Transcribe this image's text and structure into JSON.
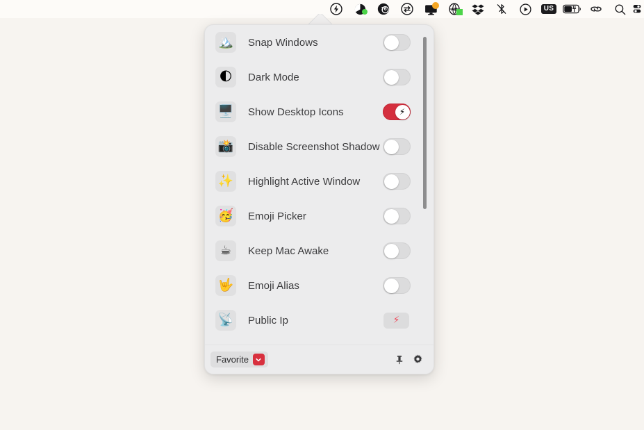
{
  "menubar": {
    "background": "#fdfbf8",
    "items": [
      {
        "name": "one-switch-icon",
        "icon": "bolt-circle",
        "badge": "none"
      },
      {
        "name": "battery-health-icon",
        "icon": "pie-circle",
        "badge": "green-dot"
      },
      {
        "name": "disk-space-icon",
        "icon": "circle-76",
        "label": "76",
        "badge": "none"
      },
      {
        "name": "transfer-icon",
        "icon": "arrows-circle",
        "badge": "none"
      },
      {
        "name": "display-icon",
        "icon": "monitor",
        "badge": "orange-dot"
      },
      {
        "name": "ad-blocker-icon",
        "icon": "ad-shield",
        "badge": "green-square"
      },
      {
        "name": "dropbox-icon",
        "icon": "dropbox",
        "badge": "none"
      },
      {
        "name": "bluetooth-off-icon",
        "icon": "bluetooth-slash",
        "badge": "none"
      },
      {
        "name": "now-playing-icon",
        "icon": "play-circle",
        "badge": "none"
      },
      {
        "name": "input-source-icon",
        "icon": "us-badge",
        "label": "US",
        "badge": "none"
      },
      {
        "name": "battery-icon",
        "icon": "battery-charging",
        "badge": "none"
      },
      {
        "name": "link-icon",
        "icon": "link-chain",
        "badge": "none"
      },
      {
        "name": "spotlight-search-icon",
        "icon": "magnifier",
        "badge": "none"
      },
      {
        "name": "control-center-icon",
        "icon": "control-center",
        "badge": "none"
      }
    ]
  },
  "panel": {
    "background": "#ececed",
    "accent_on": "#d42f3e",
    "accent_bolt": "#ef4a5c",
    "rows": [
      {
        "icon": "🏔️",
        "icon_name": "snow-mountain-emoji",
        "label": "Snap Windows",
        "control": "toggle",
        "state": "off"
      },
      {
        "icon": "🌓",
        "icon_name": "first-quarter-moon-emoji",
        "label": "Dark Mode",
        "control": "toggle",
        "state": "off"
      },
      {
        "icon": "🖥️",
        "icon_name": "desktop-computer-emoji",
        "label": "Show Desktop Icons",
        "control": "toggle",
        "state": "on",
        "knob_glyph": "⚡"
      },
      {
        "icon": "📸",
        "icon_name": "camera-flash-emoji",
        "label": "Disable Screenshot Shadow",
        "control": "toggle",
        "state": "off"
      },
      {
        "icon": "✨",
        "icon_name": "sparkles-emoji",
        "label": "Highlight Active Window",
        "control": "toggle",
        "state": "off"
      },
      {
        "icon": "🥳",
        "icon_name": "partying-face-emoji",
        "label": "Emoji Picker",
        "control": "toggle",
        "state": "off"
      },
      {
        "icon": "☕",
        "icon_name": "hot-beverage-emoji",
        "label": "Keep Mac Awake",
        "control": "toggle",
        "state": "off"
      },
      {
        "icon": "🤟",
        "icon_name": "love-you-gesture-emoji",
        "label": "Emoji Alias",
        "control": "toggle",
        "state": "off"
      },
      {
        "icon": "📡",
        "icon_name": "satellite-antenna-emoji",
        "label": "Public Ip",
        "control": "bolt-badge",
        "badge_glyph": "⚡"
      }
    ],
    "scrollbar": {
      "thumb_color": "#8d8d8e"
    }
  },
  "footer": {
    "favorite_label": "Favorite",
    "favorite_caret_color": "#d8303e",
    "pin_icon": "pin-icon",
    "settings_icon": "gear-icon"
  }
}
